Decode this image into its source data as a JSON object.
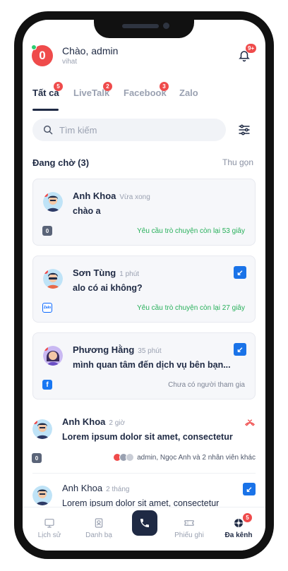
{
  "header": {
    "greeting": "Chào, admin",
    "org": "vihat",
    "logo_letter": "0",
    "notification_count": "9+"
  },
  "tabs": [
    {
      "label": "Tất cả",
      "badge": "5"
    },
    {
      "label": "LiveTalk",
      "badge": "2"
    },
    {
      "label": "Facebook",
      "badge": "3"
    },
    {
      "label": "Zalo",
      "badge": ""
    }
  ],
  "search": {
    "placeholder": "Tìm kiếm"
  },
  "waiting": {
    "title": "Đang chờ (3)",
    "collapse_label": "Thu gọn"
  },
  "waiting_items": [
    {
      "name": "Anh Khoa",
      "time": "Vừa xong",
      "message": "chào a",
      "channel": "0",
      "status": "Yêu cầu trò chuyện còn lại 53 giây"
    },
    {
      "name": "Sơn Tùng",
      "time": "1 phút",
      "message": "alo có ai không?",
      "channel": "Zalo",
      "status": "Yêu cầu trò chuyện còn lại 27 giây"
    },
    {
      "name": "Phương Hằng",
      "time": "35 phút",
      "message": "mình quan tâm đến dịch vụ bên bạn...",
      "channel": "f",
      "status": "Chưa có người tham gia"
    }
  ],
  "conversations": [
    {
      "name": "Anh Khoa",
      "time": "2 giờ",
      "message": "Lorem ipsum dolor sit amet, consectetur",
      "channel": "0",
      "agents": "admin, Ngọc Anh và 2 nhân viên khác"
    },
    {
      "name": "Anh Khoa",
      "time": "2 tháng",
      "message": "Lorem ipsum dolor sit amet, consectetur"
    }
  ],
  "bottom_nav": [
    {
      "label": "Lịch sử"
    },
    {
      "label": "Danh bạ"
    },
    {
      "label": "Phiếu ghi"
    },
    {
      "label": "Đa kênh",
      "badge": "5"
    }
  ],
  "colors": {
    "accent_red": "#ef4b4b",
    "green": "#27b05a",
    "navy": "#1f2a44",
    "livetalk_blue": "#1a73e8"
  }
}
